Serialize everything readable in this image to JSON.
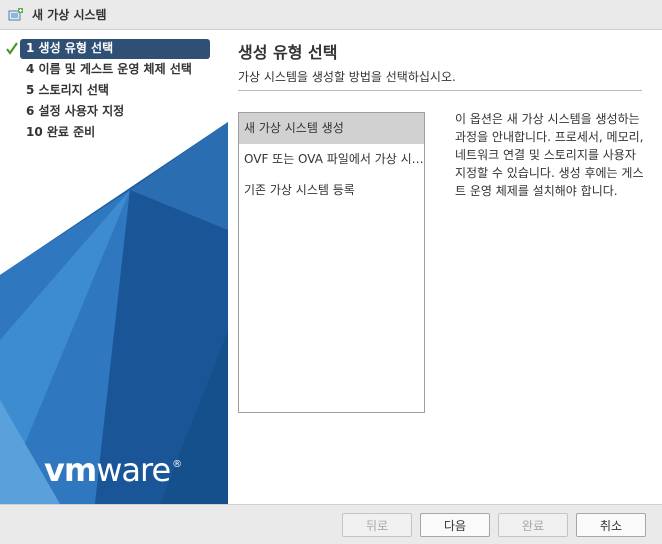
{
  "window": {
    "title": "새 가상 시스템"
  },
  "steps": [
    {
      "label": "1 생성 유형 선택",
      "active": true,
      "completed": true
    },
    {
      "label": "4 이름 및 게스트 운영 체제 선택",
      "active": false,
      "completed": false
    },
    {
      "label": "5 스토리지 선택",
      "active": false,
      "completed": false
    },
    {
      "label": "6 설정 사용자 지정",
      "active": false,
      "completed": false
    },
    {
      "label": "10 완료 준비",
      "active": false,
      "completed": false
    }
  ],
  "brand": {
    "logo_vm": "vm",
    "logo_ware": "ware",
    "logo_reg": "®",
    "color_dark_blue": "#1d5fa3",
    "color_mid_blue": "#3a86c8",
    "color_light_blue": "#7ab1df"
  },
  "main": {
    "title": "생성 유형 선택",
    "subtitle": "가상 시스템을 생성할 방법을 선택하십시오.",
    "options": [
      {
        "label": "새 가상 시스템 생성",
        "selected": true
      },
      {
        "label": "OVF 또는 OVA 파일에서 가상 시스템 배포",
        "selected": false
      },
      {
        "label": "기존 가상 시스템 등록",
        "selected": false
      }
    ],
    "description": "이 옵션은 새 가상 시스템을 생성하는 과정을 안내합니다. 프로세서, 메모리, 네트워크 연결 및 스토리지를 사용자 지정할 수 있습니다. 생성 후에는 게스트 운영 체제를 설치해야 합니다."
  },
  "footer": {
    "back_label": "뒤로",
    "next_label": "다음",
    "finish_label": "완료",
    "cancel_label": "취소"
  },
  "colors": {
    "selected_step_bg": "#2f4f74",
    "selected_option_bg": "#d1d1d1",
    "check_green": "#4a9a2a"
  }
}
